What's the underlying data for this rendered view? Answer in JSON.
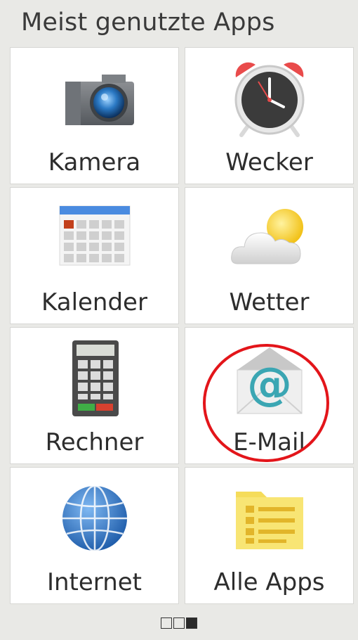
{
  "header": {
    "title": "Meist genutzte Apps"
  },
  "tiles": [
    {
      "label": "Kamera",
      "icon": "camera-icon"
    },
    {
      "label": "Wecker",
      "icon": "alarm-clock-icon"
    },
    {
      "label": "Kalender",
      "icon": "calendar-icon"
    },
    {
      "label": "Wetter",
      "icon": "weather-icon"
    },
    {
      "label": "Rechner",
      "icon": "calculator-icon"
    },
    {
      "label": "E-Mail",
      "icon": "email-icon"
    },
    {
      "label": "Internet",
      "icon": "globe-icon"
    },
    {
      "label": "Alle Apps",
      "icon": "folder-list-icon"
    }
  ],
  "pager": {
    "pages": 3,
    "active_page": 3
  },
  "colors": {
    "highlight": "#e3151a",
    "background": "#e9e9e6"
  }
}
